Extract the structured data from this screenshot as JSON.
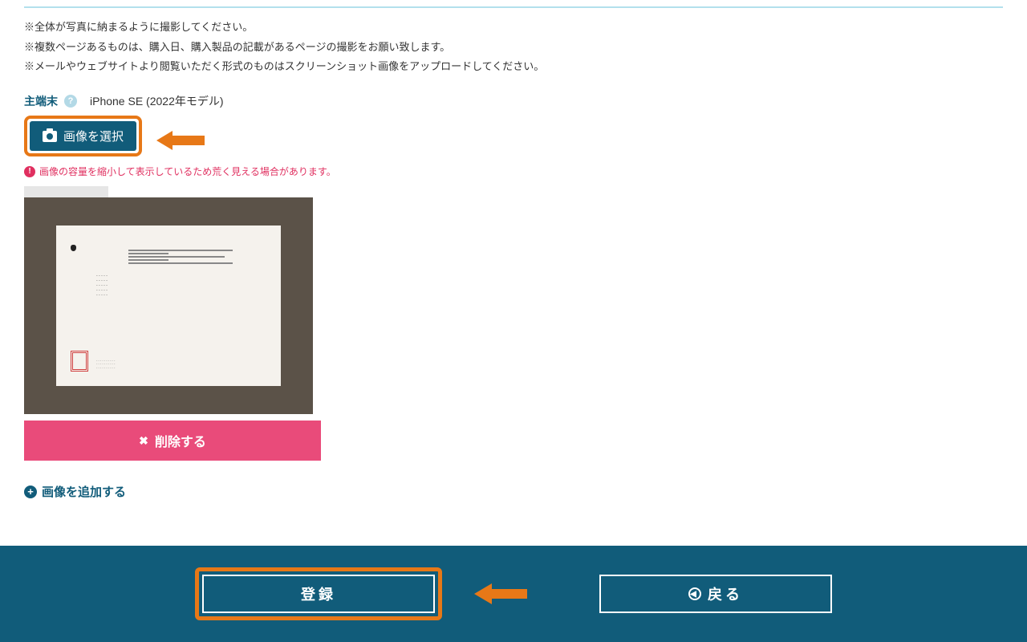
{
  "notes": {
    "line1": "※全体が写真に納まるように撮影してください。",
    "line2": "※複数ページあるものは、購入日、購入製品の記載があるページの撮影をお願い致します。",
    "line3": "※メールやウェブサイトより閲覧いただく形式のものはスクリーンショット画像をアップロードしてください。"
  },
  "device": {
    "label": "主端末",
    "help_icon": "?",
    "name": "iPhone SE (2022年モデル)"
  },
  "select_button": {
    "label": "画像を選択"
  },
  "warning": {
    "icon": "!",
    "text": "画像の容量を縮小して表示しているため荒く見える場合があります。"
  },
  "delete_button": {
    "icon": "✖",
    "label": "削除する"
  },
  "add_link": {
    "icon": "+",
    "label": "画像を追加する"
  },
  "footer": {
    "submit_label": "登録",
    "back_label": "戻る",
    "back_icon": "◀"
  }
}
